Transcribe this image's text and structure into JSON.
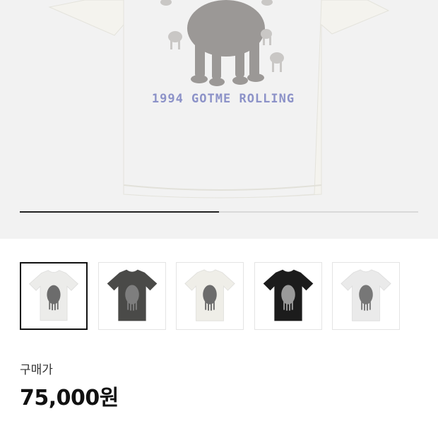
{
  "product": {
    "print_text": "1994 GOTME ROLLING",
    "gallery": {
      "progress": 0.5,
      "selected_index": 0,
      "thumbnails": [
        {
          "name": "thumbnail-white-tee",
          "shirt_color": "#ececea",
          "print_color": "#6c6c6c"
        },
        {
          "name": "thumbnail-charcoal-tee",
          "shirt_color": "#4a4a48",
          "print_color": "#7e7e7e"
        },
        {
          "name": "thumbnail-ivory-tee",
          "shirt_color": "#efeee8",
          "print_color": "#6c6c6c"
        },
        {
          "name": "thumbnail-black-tee",
          "shirt_color": "#1c1c1c",
          "print_color": "#9a9a9a"
        },
        {
          "name": "thumbnail-light-grey-tee",
          "shirt_color": "#eaeaea",
          "print_color": "#777777"
        }
      ]
    },
    "price_label": "구매가",
    "price_value": "75,000원"
  },
  "colors": {
    "hero_background": "#f2f2f2",
    "hero_shirt": "#f4f3ee",
    "print_text": "#8c92c8",
    "progress_fill": "#222222"
  }
}
